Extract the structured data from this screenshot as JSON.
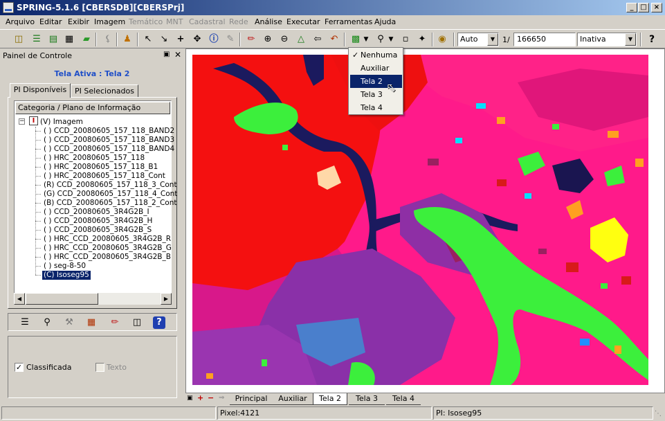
{
  "window": {
    "title": "SPRING-5.1.6 [CBERSDB][CBERSPrj]",
    "controls": [
      "_",
      "□",
      "×"
    ]
  },
  "menu": [
    "Arquivo",
    "Editar",
    "Exibir",
    "Imagem",
    "Temático",
    "MNT",
    "Cadastral",
    "Rede",
    "Análise",
    "Executar",
    "Ferramentas",
    "Ajuda"
  ],
  "toolbar": {
    "scale_mode": "Auto",
    "scale_prefix": "1/",
    "scale_value": "166650",
    "status_select": "Inativa",
    "help": "?"
  },
  "panel": {
    "title": "Painel de Controle",
    "active_screen": "Tela Ativa : Tela 2",
    "tabs": [
      "PI Disponíveis",
      "PI Selecionados"
    ],
    "column_header": "Categoria / Plano de Informação",
    "category": "(V) Imagem",
    "items": [
      "( ) CCD_20080605_157_118_BAND2",
      "( ) CCD_20080605_157_118_BAND3",
      "( ) CCD_20080605_157_118_BAND4",
      "( ) HRC_20080605_157_118",
      "( ) HRC_20080605_157_118_B1",
      "( ) HRC_20080605_157_118_Cont",
      "(R) CCD_20080605_157_118_3_Cont",
      "(G) CCD_20080605_157_118_4_Cont",
      "(B) CCD_20080605_157_118_2_Cont",
      "( ) CCD_20080605_3R4G2B_I",
      "( ) CCD_20080605_3R4G2B_H",
      "( ) CCD_20080605_3R4G2B_S",
      "( ) HRC_CCD_20080605_3R4G2B_R",
      "( ) HRC_CCD_20080605_3R4G2B_G",
      "( ) HRC_CCD_20080605_3R4G2B_B",
      "( ) seg-8-50",
      "(C) Isoseg95"
    ],
    "options": {
      "classificada": "Classificada",
      "texto": "Texto"
    }
  },
  "dropdown": {
    "items": [
      "Nenhuma",
      "Auxiliar",
      "Tela 2",
      "Tela 3",
      "Tela 4"
    ],
    "checked": "Nenhuma",
    "highlighted": "Tela 2"
  },
  "bottom_tabs": [
    "Principal",
    "Auxiliar",
    "Tela 2",
    "Tela 3",
    "Tela 4"
  ],
  "active_bottom_tab": "Tela 2",
  "status": {
    "pixel": "Pixel:4121",
    "pi": "PI: Isoseg95"
  }
}
